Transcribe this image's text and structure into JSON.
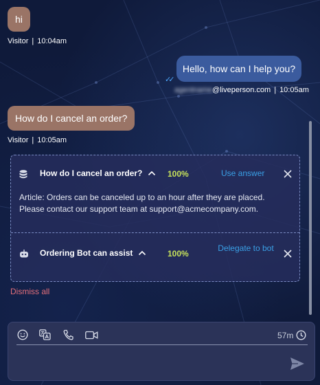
{
  "messages": [
    {
      "from": "visitor",
      "text": "hi",
      "sender": "Visitor",
      "time": "10:04am"
    },
    {
      "from": "agent",
      "text": "Hello, how can I help you?",
      "email_hidden": "agentname",
      "email_domain": "@liveperson.com",
      "time": "10:05am"
    },
    {
      "from": "visitor",
      "text": "How do I cancel an order?",
      "sender": "Visitor",
      "time": "10:05am"
    }
  ],
  "suggestions": [
    {
      "title": "How do I cancel an order?",
      "confidence": "100%",
      "action": "Use answer",
      "body": "Article: Orders can be canceled up to an hour after they are placed. Please contact our support team at support@acmecompany.com."
    },
    {
      "title": "Ordering Bot can assist",
      "confidence": "100%",
      "action": "Delegate to bot"
    }
  ],
  "dismiss_all": "Dismiss all",
  "composer": {
    "timer": "57m"
  },
  "colors": {
    "accent": "#3aa0e6",
    "confidence": "#c8e35a",
    "dismiss": "#e46f7a",
    "visitor_bubble": "#9a7466",
    "agent_bubble": "#3b5b9e"
  }
}
